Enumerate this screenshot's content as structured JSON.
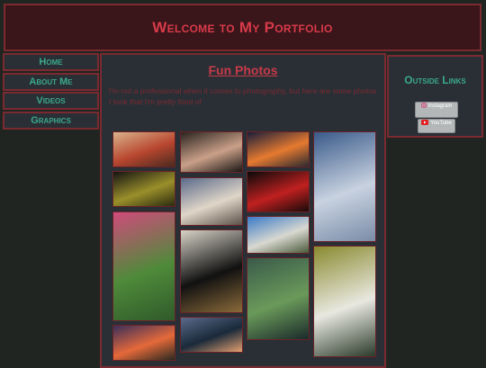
{
  "header": {
    "title": "Welcome to My Portfolio"
  },
  "nav": {
    "items": [
      {
        "label": "Home"
      },
      {
        "label": "About Me"
      },
      {
        "label": "Videos"
      },
      {
        "label": "Graphics"
      }
    ]
  },
  "main": {
    "title": "Fun Photos",
    "intro": "I'm not a professional when it comes to photography, but here are some photos I took that I'm pretty fond of"
  },
  "side": {
    "title": "Outside Links",
    "links": [
      {
        "label": "Instagram",
        "icon": "instagram-icon"
      },
      {
        "label": "YouTube",
        "icon": "youtube-icon"
      }
    ]
  },
  "photos": [
    {
      "subject": "dessert-plate",
      "colors": [
        "#d9b38c",
        "#b8462f",
        "#4a2a1e"
      ]
    },
    {
      "subject": "cat-eye",
      "colors": [
        "#141414",
        "#9a8f2a",
        "#2a2a10"
      ]
    },
    {
      "subject": "pink-flowers",
      "colors": [
        "#cf4b7c",
        "#4f8a3a",
        "#2f5a2a"
      ]
    },
    {
      "subject": "sunset-field",
      "colors": [
        "#3a2f5a",
        "#e5693a",
        "#2a2a20"
      ]
    },
    {
      "subject": "hands",
      "colors": [
        "#2a2420",
        "#caa089",
        "#1a1614"
      ]
    },
    {
      "subject": "beach-sunset",
      "colors": [
        "#5a6a8a",
        "#e0d6c8",
        "#5a5048"
      ]
    },
    {
      "subject": "black-cat",
      "colors": [
        "#d8d4c8",
        "#111111",
        "#8a6a3a"
      ]
    },
    {
      "subject": "mountain-dusk",
      "colors": [
        "#5a6a8a",
        "#1a2a3a",
        "#e2a070"
      ]
    },
    {
      "subject": "city-sunset",
      "colors": [
        "#1a1e3a",
        "#e67a30",
        "#2a2a30"
      ]
    },
    {
      "subject": "red-light-dark",
      "colors": [
        "#0a0a0a",
        "#c02020",
        "#1a0a0a"
      ]
    },
    {
      "subject": "blue-sky-town",
      "colors": [
        "#3a7ac8",
        "#d8d8d0",
        "#4a5a3a"
      ]
    },
    {
      "subject": "lizard-plant",
      "colors": [
        "#3a5a4a",
        "#6a9a5a",
        "#1a2a2a"
      ]
    },
    {
      "subject": "clouds-sky",
      "colors": [
        "#3a5a8a",
        "#c8d2e0",
        "#7a8ca8"
      ]
    },
    {
      "subject": "white-flower",
      "colors": [
        "#8a8a30",
        "#e8e8e0",
        "#2a3a2a"
      ]
    }
  ]
}
